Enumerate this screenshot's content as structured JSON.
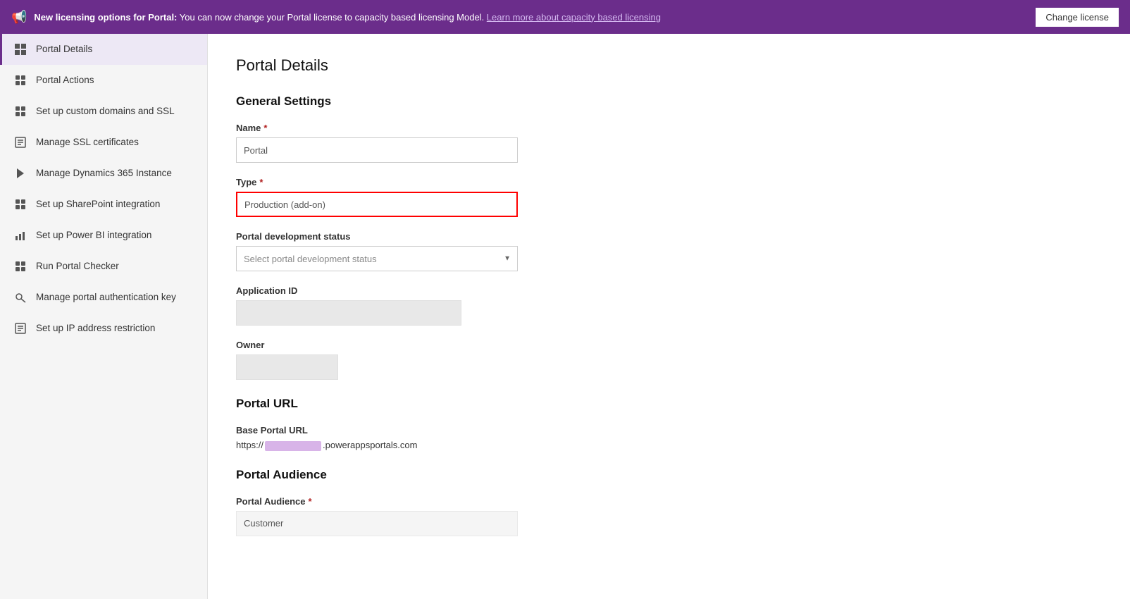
{
  "banner": {
    "icon": "📢",
    "text_bold": "New licensing options for Portal:",
    "text_normal": " You can now change your Portal license to capacity based licensing Model. ",
    "link_text": "Learn more about capacity based licensing",
    "button_label": "Change license"
  },
  "sidebar": {
    "items": [
      {
        "id": "portal-details",
        "label": "Portal Details",
        "icon": "☰",
        "active": true
      },
      {
        "id": "portal-actions",
        "label": "Portal Actions",
        "icon": "⊞"
      },
      {
        "id": "custom-domains",
        "label": "Set up custom domains and SSL",
        "icon": "⊞"
      },
      {
        "id": "ssl-certificates",
        "label": "Manage SSL certificates",
        "icon": "📄"
      },
      {
        "id": "dynamics-instance",
        "label": "Manage Dynamics 365 Instance",
        "icon": "▶"
      },
      {
        "id": "sharepoint",
        "label": "Set up SharePoint integration",
        "icon": "⊞"
      },
      {
        "id": "power-bi",
        "label": "Set up Power BI integration",
        "icon": "📊"
      },
      {
        "id": "portal-checker",
        "label": "Run Portal Checker",
        "icon": "⊞"
      },
      {
        "id": "auth-key",
        "label": "Manage portal authentication key",
        "icon": "🔒"
      },
      {
        "id": "ip-restriction",
        "label": "Set up IP address restriction",
        "icon": "📄"
      }
    ]
  },
  "content": {
    "page_title": "Portal Details",
    "general_settings_title": "General Settings",
    "name_label": "Name",
    "name_value": "Portal",
    "type_label": "Type",
    "type_value": "Production (add-on)",
    "dev_status_label": "Portal development status",
    "dev_status_placeholder": "Select portal development status",
    "app_id_label": "Application ID",
    "owner_label": "Owner",
    "portal_url_title": "Portal URL",
    "base_url_label": "Base Portal URL",
    "base_url_prefix": "https://",
    "base_url_suffix": ".powerappsportals.com",
    "portal_audience_title": "Portal Audience",
    "portal_audience_label": "Portal Audience",
    "portal_audience_value": "Customer"
  }
}
